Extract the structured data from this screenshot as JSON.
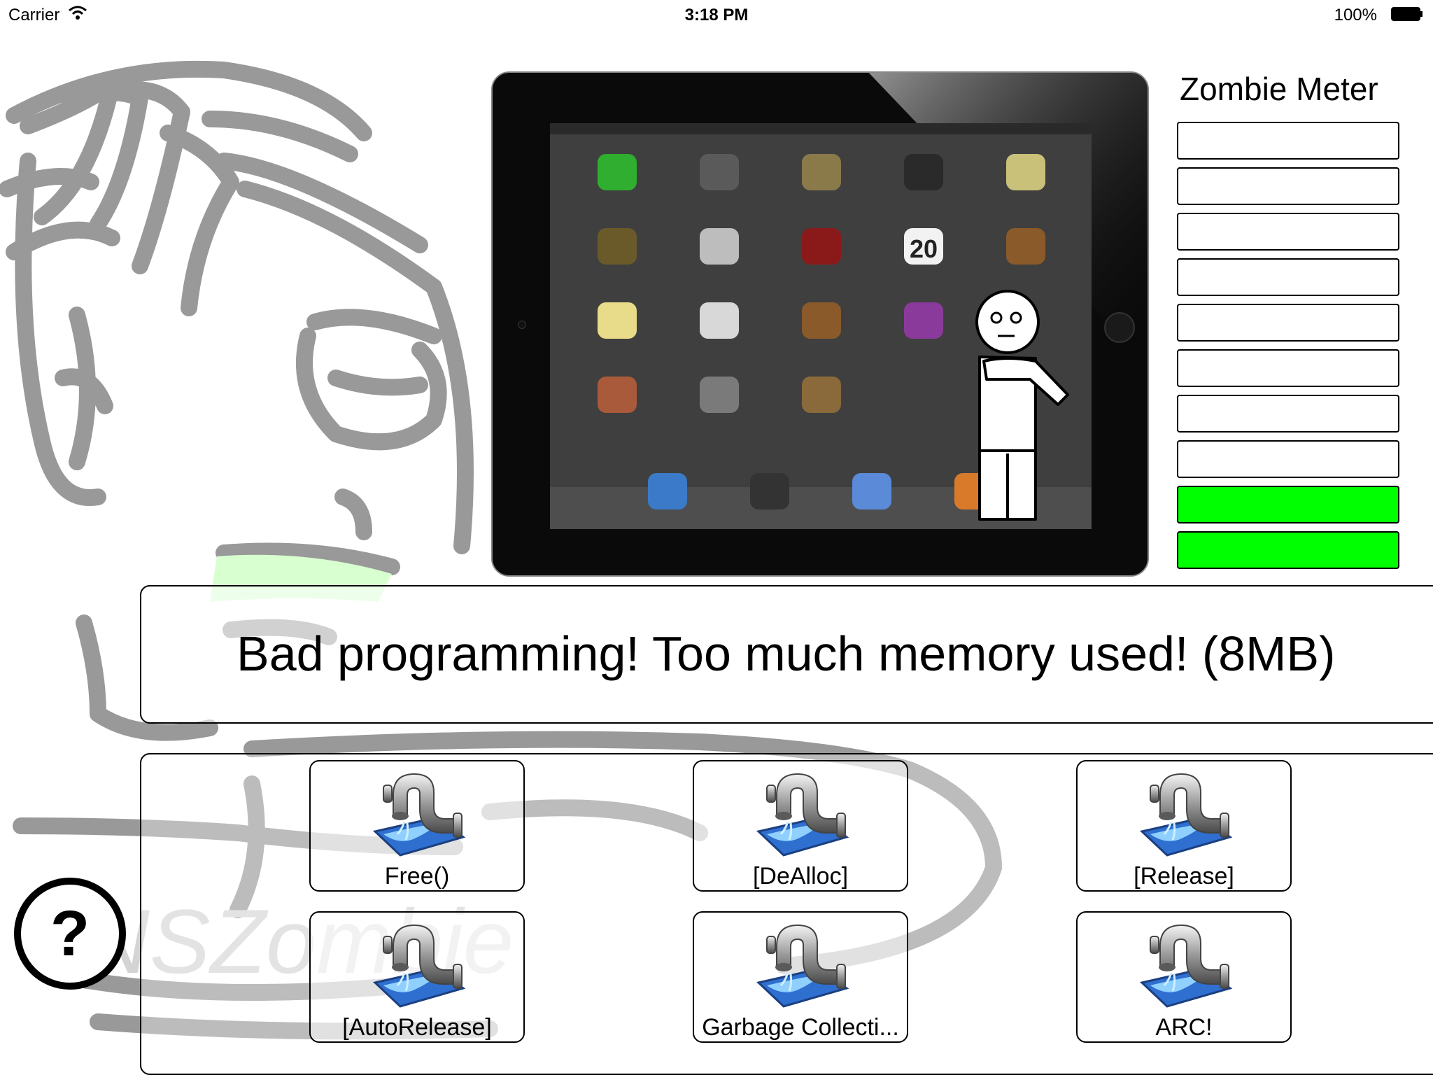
{
  "status_bar": {
    "carrier": "Carrier",
    "time": "3:18 PM",
    "battery": "100%"
  },
  "watermark": "NSZombie",
  "ipad_screen": {
    "date_badge": "20"
  },
  "zombie_meter": {
    "title": "Zombie Meter",
    "total_bars": 10,
    "filled_bars": 2,
    "fill_color": "#00ff00"
  },
  "message": "Bad programming! Too much memory used! (8MB)",
  "buttons": [
    {
      "label": "Free()"
    },
    {
      "label": "[DeAlloc]"
    },
    {
      "label": "[Release]"
    },
    {
      "label": "[AutoRelease]"
    },
    {
      "label": "Garbage Collecti..."
    },
    {
      "label": "ARC!"
    }
  ],
  "help_button": "?"
}
